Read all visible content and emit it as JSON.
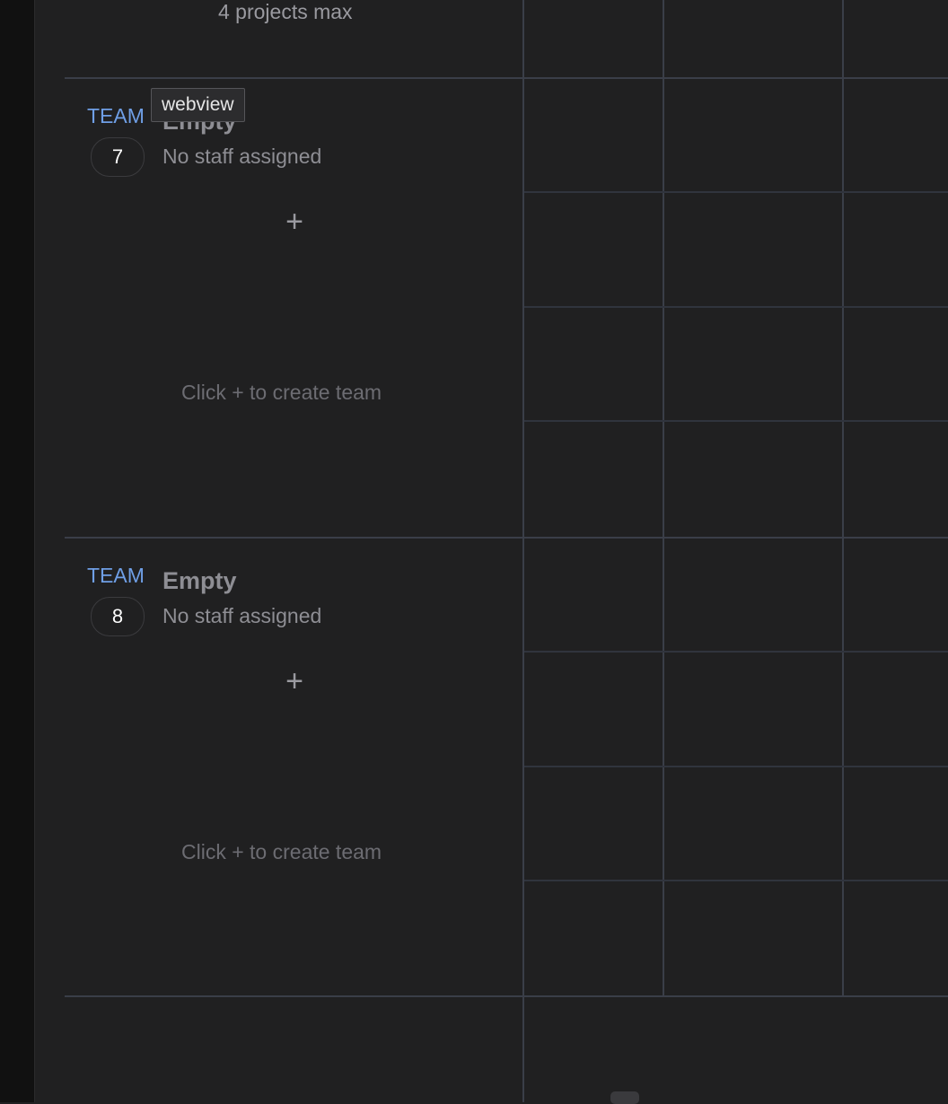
{
  "top": {
    "projects_max": "4 projects max"
  },
  "tooltip": {
    "text": "webview"
  },
  "teams": [
    {
      "label": "TEAM",
      "number": "7",
      "status": "Empty",
      "staff": "No staff assigned",
      "add": "+",
      "hint": "Click + to create team"
    },
    {
      "label": "TEAM",
      "number": "8",
      "status": "Empty",
      "staff": "No staff assigned",
      "add": "+",
      "hint": "Click + to create team"
    }
  ],
  "colors": {
    "background": "#202021",
    "team_label": "#6f9fe6",
    "grid_line": "#3a3e48"
  }
}
